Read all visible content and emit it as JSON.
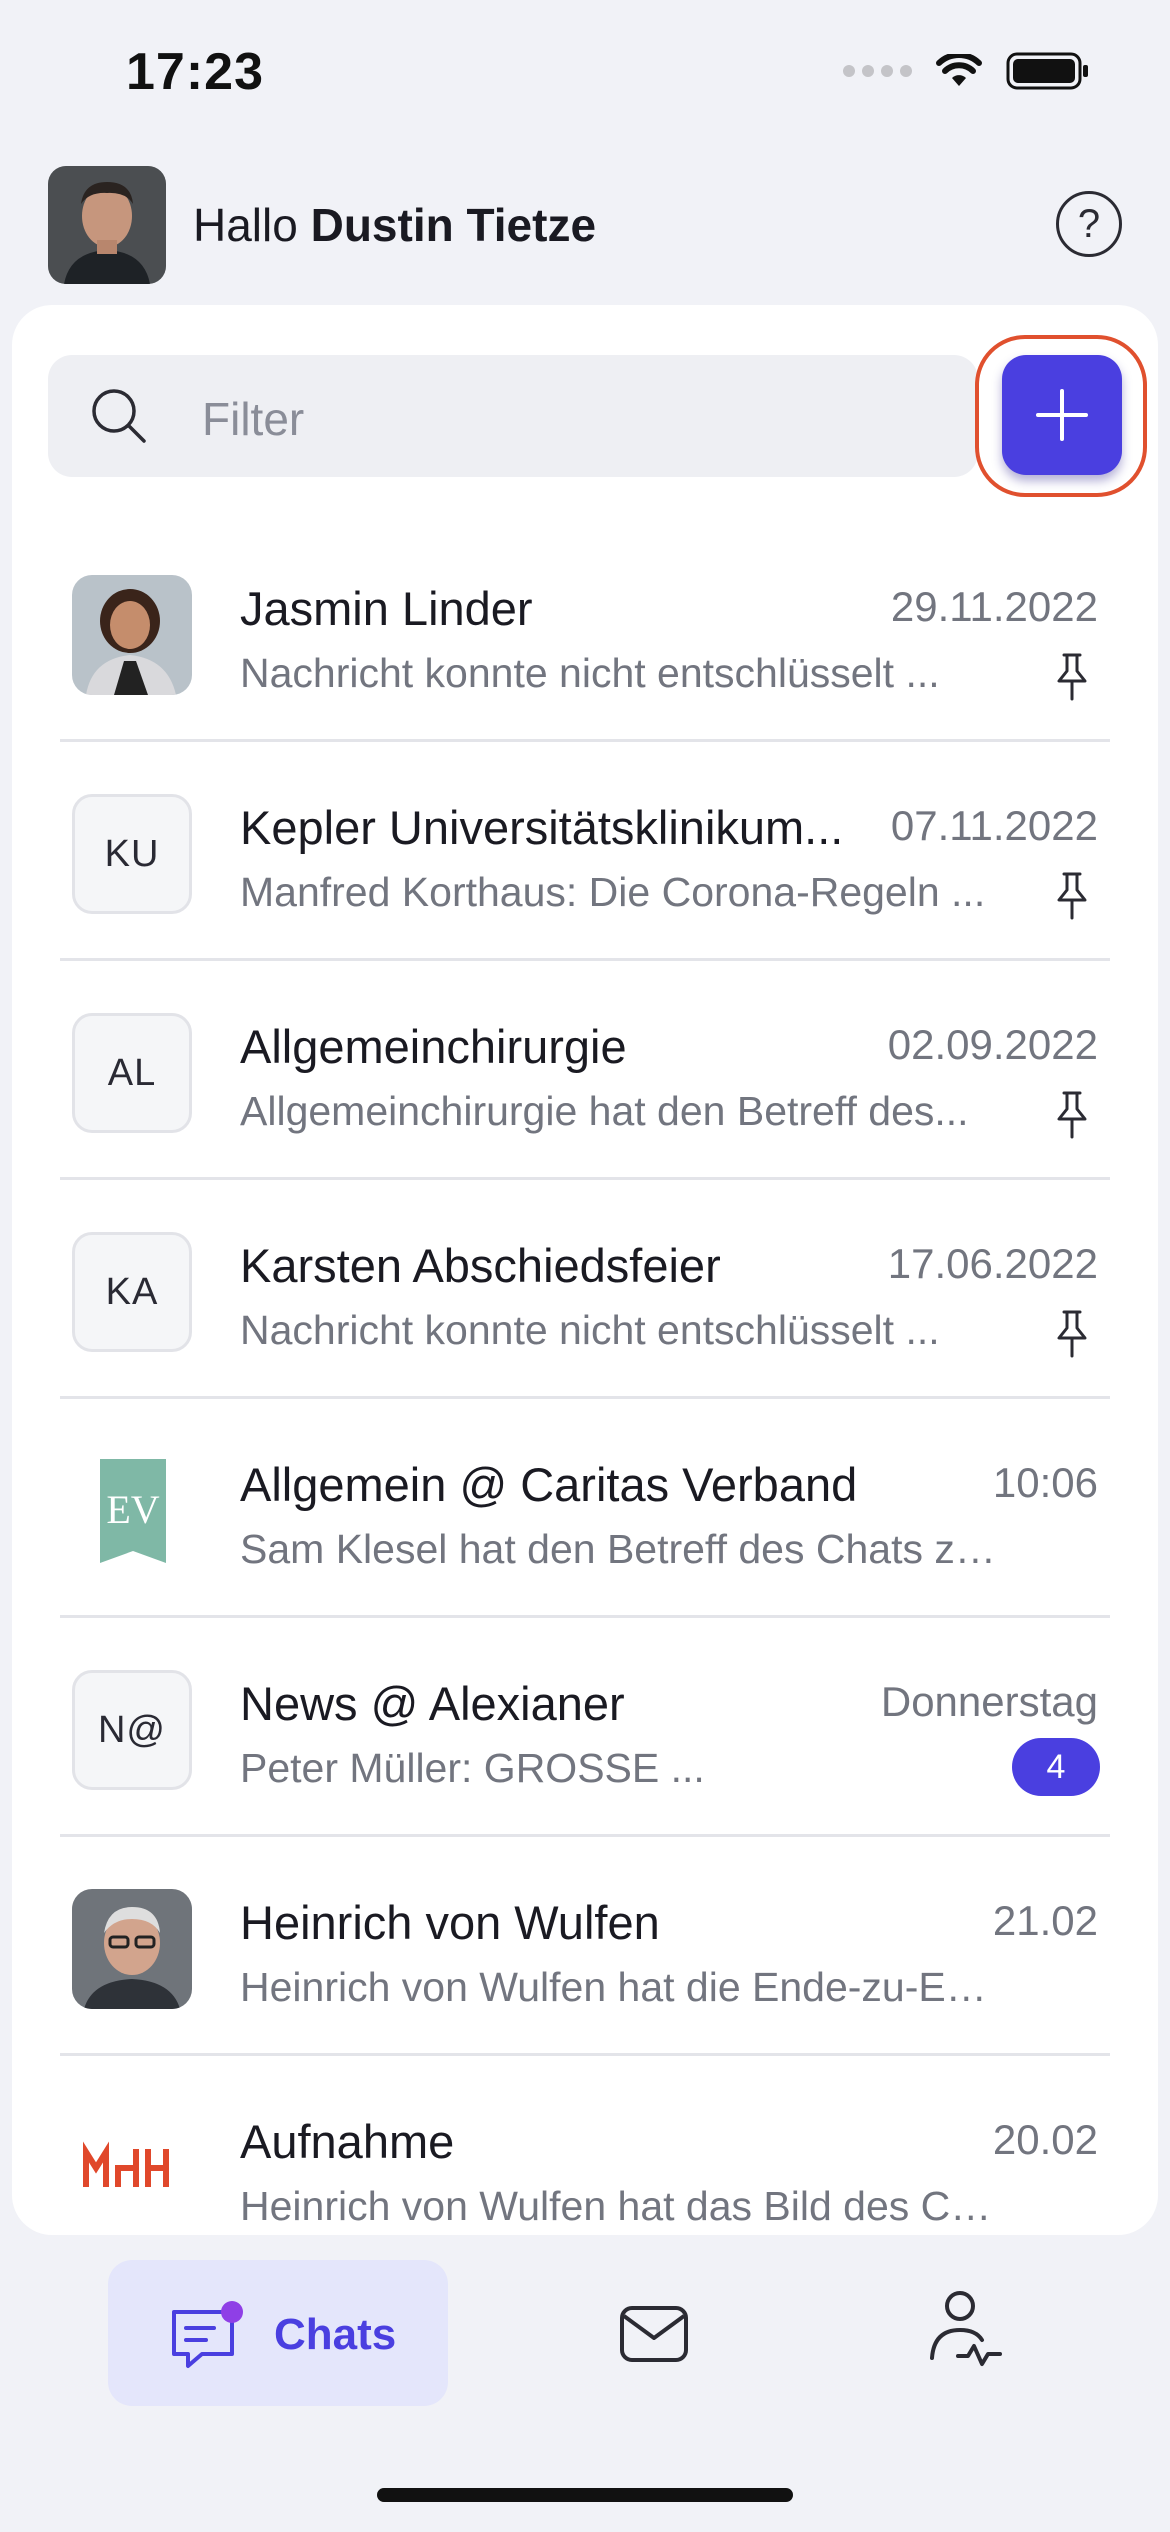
{
  "status_bar": {
    "time": "17:23"
  },
  "header": {
    "greeting": "Hallo",
    "user_name": "Dustin Tietze",
    "help_symbol": "?"
  },
  "search": {
    "placeholder": "Filter"
  },
  "chats": [
    {
      "title": "Jasmin Linder",
      "date": "29.11.2022",
      "preview": "Nachricht konnte nicht entschlüsselt ...",
      "avatar": "photo-woman",
      "pinned": true
    },
    {
      "title": "Kepler Universitätsklinikum...",
      "date": "07.11.2022",
      "preview": "Manfred Korthaus: Die Corona-Regeln ...",
      "avatar_initials": "KU",
      "pinned": true
    },
    {
      "title": "Allgemeinchirurgie",
      "date": "02.09.2022",
      "preview": "Allgemeinchirurgie hat den Betreff des...",
      "avatar_initials": "AL",
      "pinned": true
    },
    {
      "title": "Karsten Abschiedsfeier",
      "date": "17.06.2022",
      "preview": "Nachricht konnte nicht entschlüsselt ...",
      "avatar_initials": "KA",
      "pinned": true
    },
    {
      "title": "Allgemein @ Caritas Verband",
      "date": "10:06",
      "preview": "Sam Klesel hat den Betreff des Chats zu ...",
      "avatar_logo": "EV"
    },
    {
      "title": "News @ Alexianer",
      "date": "Donnerstag",
      "preview": "Peter Müller: GROSSE ...",
      "avatar_initials": "N@",
      "unread": "4"
    },
    {
      "title": "Heinrich von Wulfen",
      "date": "21.02",
      "preview": "Heinrich von Wulfen hat die Ende-zu-Ende...",
      "avatar": "photo-man"
    },
    {
      "title": "Aufnahme",
      "date": "20.02",
      "preview": "Heinrich von Wulfen hat das Bild des Chat...",
      "avatar_logo": "MHH"
    }
  ],
  "tabbar": {
    "chats_label": "Chats"
  },
  "colors": {
    "accent": "#4a3fe0",
    "highlight_ring": "#e0502e",
    "evangelisch_green": "#7fb8a6",
    "mhh_red": "#e0482b"
  }
}
